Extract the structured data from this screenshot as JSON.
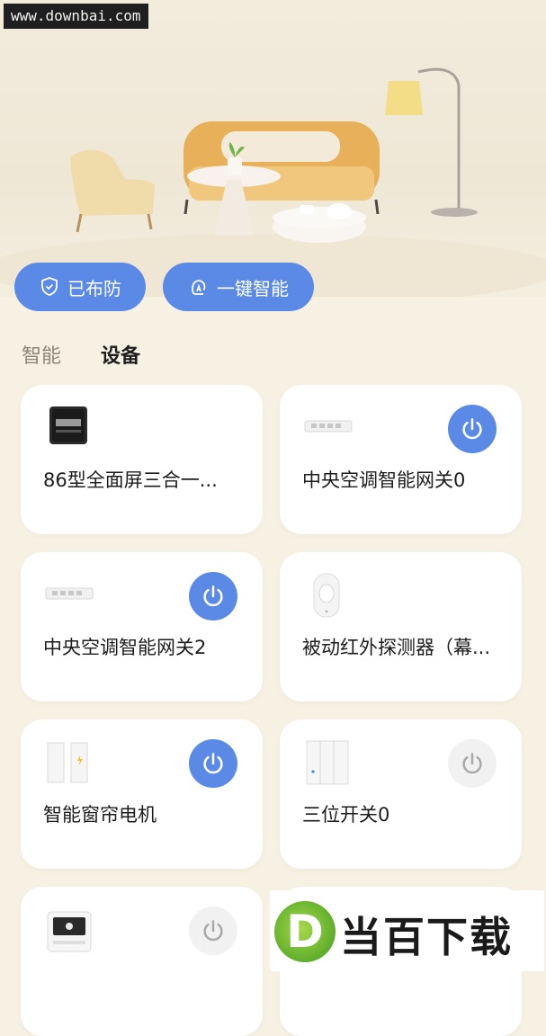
{
  "watermark": "www.downbai.com",
  "actions": {
    "armed_label": "已布防",
    "smart_label": "一键智能"
  },
  "tabs": [
    {
      "label": "智能"
    },
    {
      "label": "设备"
    }
  ],
  "devices": [
    {
      "name": "86型全面屏三合一...",
      "power": "none"
    },
    {
      "name": "中央空调智能网关0",
      "power": "on"
    },
    {
      "name": "中央空调智能网关2",
      "power": "on"
    },
    {
      "name": "被动红外探测器（幕...",
      "power": "none"
    },
    {
      "name": "智能窗帘电机",
      "power": "on"
    },
    {
      "name": "三位开关0",
      "power": "off"
    },
    {
      "name": "",
      "power": "off"
    }
  ],
  "ad": {
    "logo_letter": "D",
    "text": "当百下载"
  },
  "colors": {
    "accent": "#5a8ae5",
    "background": "#f6f1e3",
    "card": "#ffffff"
  }
}
